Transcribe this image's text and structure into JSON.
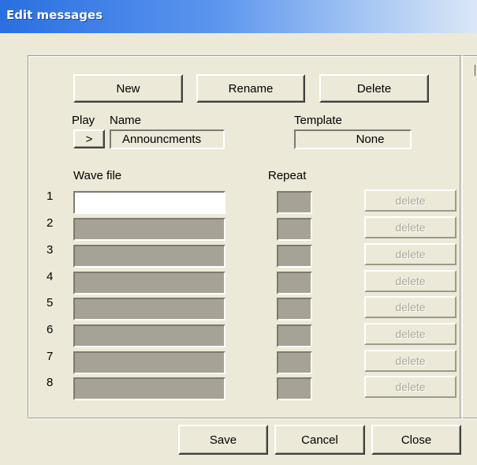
{
  "window": {
    "title": "Edit messages"
  },
  "toolbar": {
    "new_label": "New",
    "rename_label": "Rename",
    "delete_label": "Delete"
  },
  "header": {
    "play_label": "Play",
    "name_label": "Name",
    "play_button": ">",
    "name_value": "Announcments",
    "template_label": "Template",
    "template_value": "None"
  },
  "columns": {
    "wave_file": "Wave file",
    "repeat": "Repeat"
  },
  "rows": [
    {
      "num": "1",
      "wave_file": "",
      "repeat": "",
      "delete_label": "delete"
    },
    {
      "num": "2",
      "wave_file": "",
      "repeat": "",
      "delete_label": "delete"
    },
    {
      "num": "3",
      "wave_file": "",
      "repeat": "",
      "delete_label": "delete"
    },
    {
      "num": "4",
      "wave_file": "",
      "repeat": "",
      "delete_label": "delete"
    },
    {
      "num": "5",
      "wave_file": "",
      "repeat": "",
      "delete_label": "delete"
    },
    {
      "num": "6",
      "wave_file": "",
      "repeat": "",
      "delete_label": "delete"
    },
    {
      "num": "7",
      "wave_file": "",
      "repeat": "",
      "delete_label": "delete"
    },
    {
      "num": "8",
      "wave_file": "",
      "repeat": "",
      "delete_label": "delete"
    }
  ],
  "footer": {
    "save_label": "Save",
    "cancel_label": "Cancel",
    "close_label": "Close"
  }
}
